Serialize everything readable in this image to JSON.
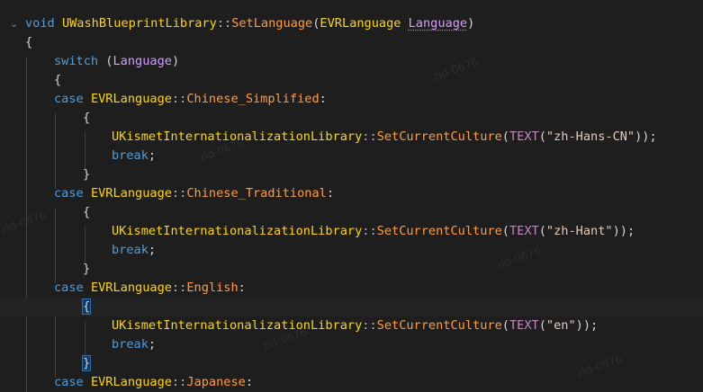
{
  "code": {
    "signature": {
      "return_type": "void",
      "class_name": "UWashBlueprintLibrary",
      "scope": "::",
      "method": "SetLanguage",
      "open_paren": "(",
      "param_type": "EVRLanguage",
      "param_name": "Language",
      "close_paren": ")"
    },
    "open_brace": "{",
    "close_brace": "}",
    "switch_kw": "switch",
    "switch_expr_open": "(",
    "switch_expr": "Language",
    "switch_expr_close": ")",
    "case_kw": "case",
    "enum_type": "EVRLanguage",
    "scope_op": "::",
    "colon": ":",
    "lib_class": "UKismetInternationalizationLibrary",
    "lib_method": "SetCurrentCulture",
    "text_macro": "TEXT",
    "break_kw": "break",
    "semicolon": ";",
    "cases": [
      {
        "enum_value": "Chinese_Simplified",
        "culture": "\"zh-Hans-CN\""
      },
      {
        "enum_value": "Chinese_Traditional",
        "culture": "\"zh-Hant\""
      },
      {
        "enum_value": "English",
        "culture": "\"en\""
      },
      {
        "enum_value": "Japanese",
        "culture": ""
      }
    ],
    "call_tail": "));"
  },
  "watermarks": [
    "zld-0676",
    "zld-0676",
    "zld-0676",
    "zld-0676",
    "zld-0676",
    "zld-0676"
  ],
  "colors": {
    "background": "#1e1e1e",
    "keyword": "#569cd6",
    "class": "#dcdcaa",
    "function": "#ff8c00",
    "enum_value": "#ff9d3b",
    "parameter": "#d69dff",
    "string": "#e8c9bb",
    "macro": "#c586c0"
  }
}
